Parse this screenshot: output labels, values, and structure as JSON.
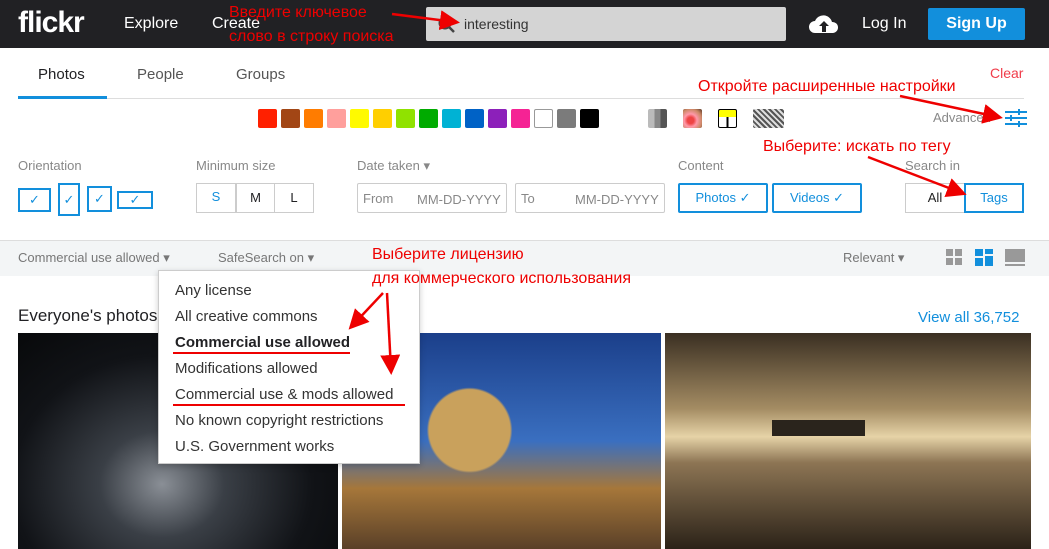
{
  "header": {
    "logo": "flickr",
    "nav": [
      "Explore",
      "Create"
    ],
    "search_value": "interesting",
    "login": "Log In",
    "signup": "Sign Up"
  },
  "tabs": [
    "Photos",
    "People",
    "Groups"
  ],
  "clear": "Clear",
  "advanced": "Advanced",
  "colors": [
    "#ff2000",
    "#a24615",
    "#ff7c00",
    "#ff9f9c",
    "#fffa00",
    "#ffcf00",
    "#90e200",
    "#00ab00",
    "#00b2d4",
    "#0062c6",
    "#8c20ba",
    "#f52394",
    "#ffffff",
    "#7b7b7b",
    "#000000"
  ],
  "filters": {
    "orientation": "Orientation",
    "min_size": "Minimum size",
    "sizes": [
      "S",
      "M",
      "L"
    ],
    "date_taken": "Date taken",
    "from": "From",
    "to": "To",
    "date_placeholder": "MM-DD-YYYY",
    "content": "Content",
    "photos": "Photos",
    "videos": "Videos",
    "search_in": "Search in",
    "all": "All",
    "tags": "Tags"
  },
  "toolbar": {
    "license": "Commercial use allowed",
    "safesearch": "SafeSearch on",
    "sort": "Relevant"
  },
  "license_options": [
    "Any license",
    "All creative commons",
    "Commercial use allowed",
    "Modifications allowed",
    "Commercial use & mods allowed",
    "No known copyright restrictions",
    "U.S. Government works"
  ],
  "results": {
    "title": "Everyone's photos",
    "view_all": "View all 36,752"
  },
  "annotations": {
    "search": [
      "Введите ключевое",
      "слово в строку поиска"
    ],
    "advanced": "Откройте расширенные настройки",
    "tags": "Выберите: искать по тегу",
    "license": [
      "Выберите лицензию",
      "для коммерческого использования"
    ]
  }
}
